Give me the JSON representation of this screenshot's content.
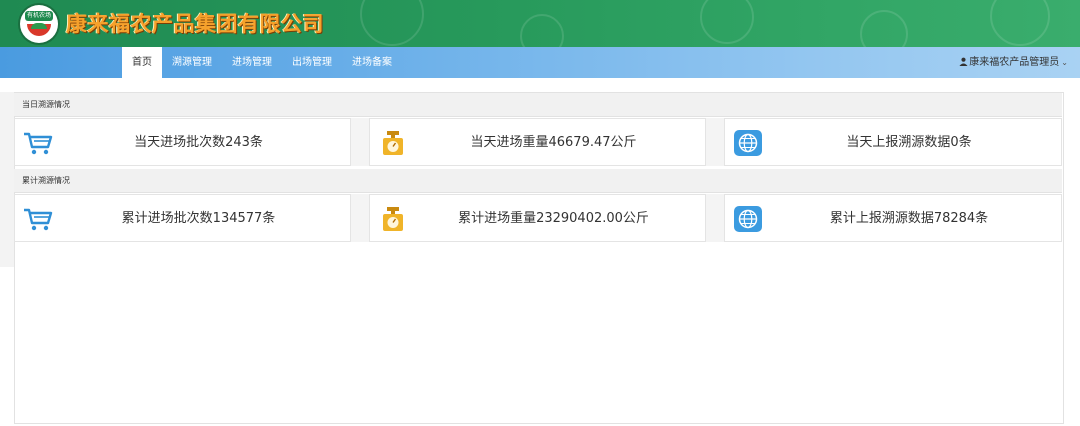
{
  "header": {
    "company_name": "康来福农产品集团有限公司",
    "logo_text": "有机农场",
    "bg_color": "#27995b",
    "title_color": "#f6a12b"
  },
  "nav": {
    "items": [
      {
        "label": "首页",
        "active": true
      },
      {
        "label": "溯源管理"
      },
      {
        "label": "进场管理"
      },
      {
        "label": "出场管理"
      },
      {
        "label": "进场备案"
      }
    ],
    "user_label": "康来福农产品管理员",
    "user_icon": "person-icon",
    "dropdown_icon": "chevron-down-icon"
  },
  "today": {
    "section_title": "当日溯源情况",
    "cards": [
      {
        "icon": "cart-icon",
        "text": "当天进场批次数243条"
      },
      {
        "icon": "scale-icon",
        "text": "当天进场重量46679.47公斤"
      },
      {
        "icon": "globe-icon",
        "text": "当天上报溯源数据0条"
      }
    ]
  },
  "total": {
    "section_title": "累计溯源情况",
    "cards": [
      {
        "icon": "cart-icon",
        "text": "累计进场批次数134577条"
      },
      {
        "icon": "scale-icon",
        "text": "累计进场重量23290402.00公斤"
      },
      {
        "icon": "globe-icon",
        "text": "累计上报溯源数据78284条"
      }
    ]
  }
}
